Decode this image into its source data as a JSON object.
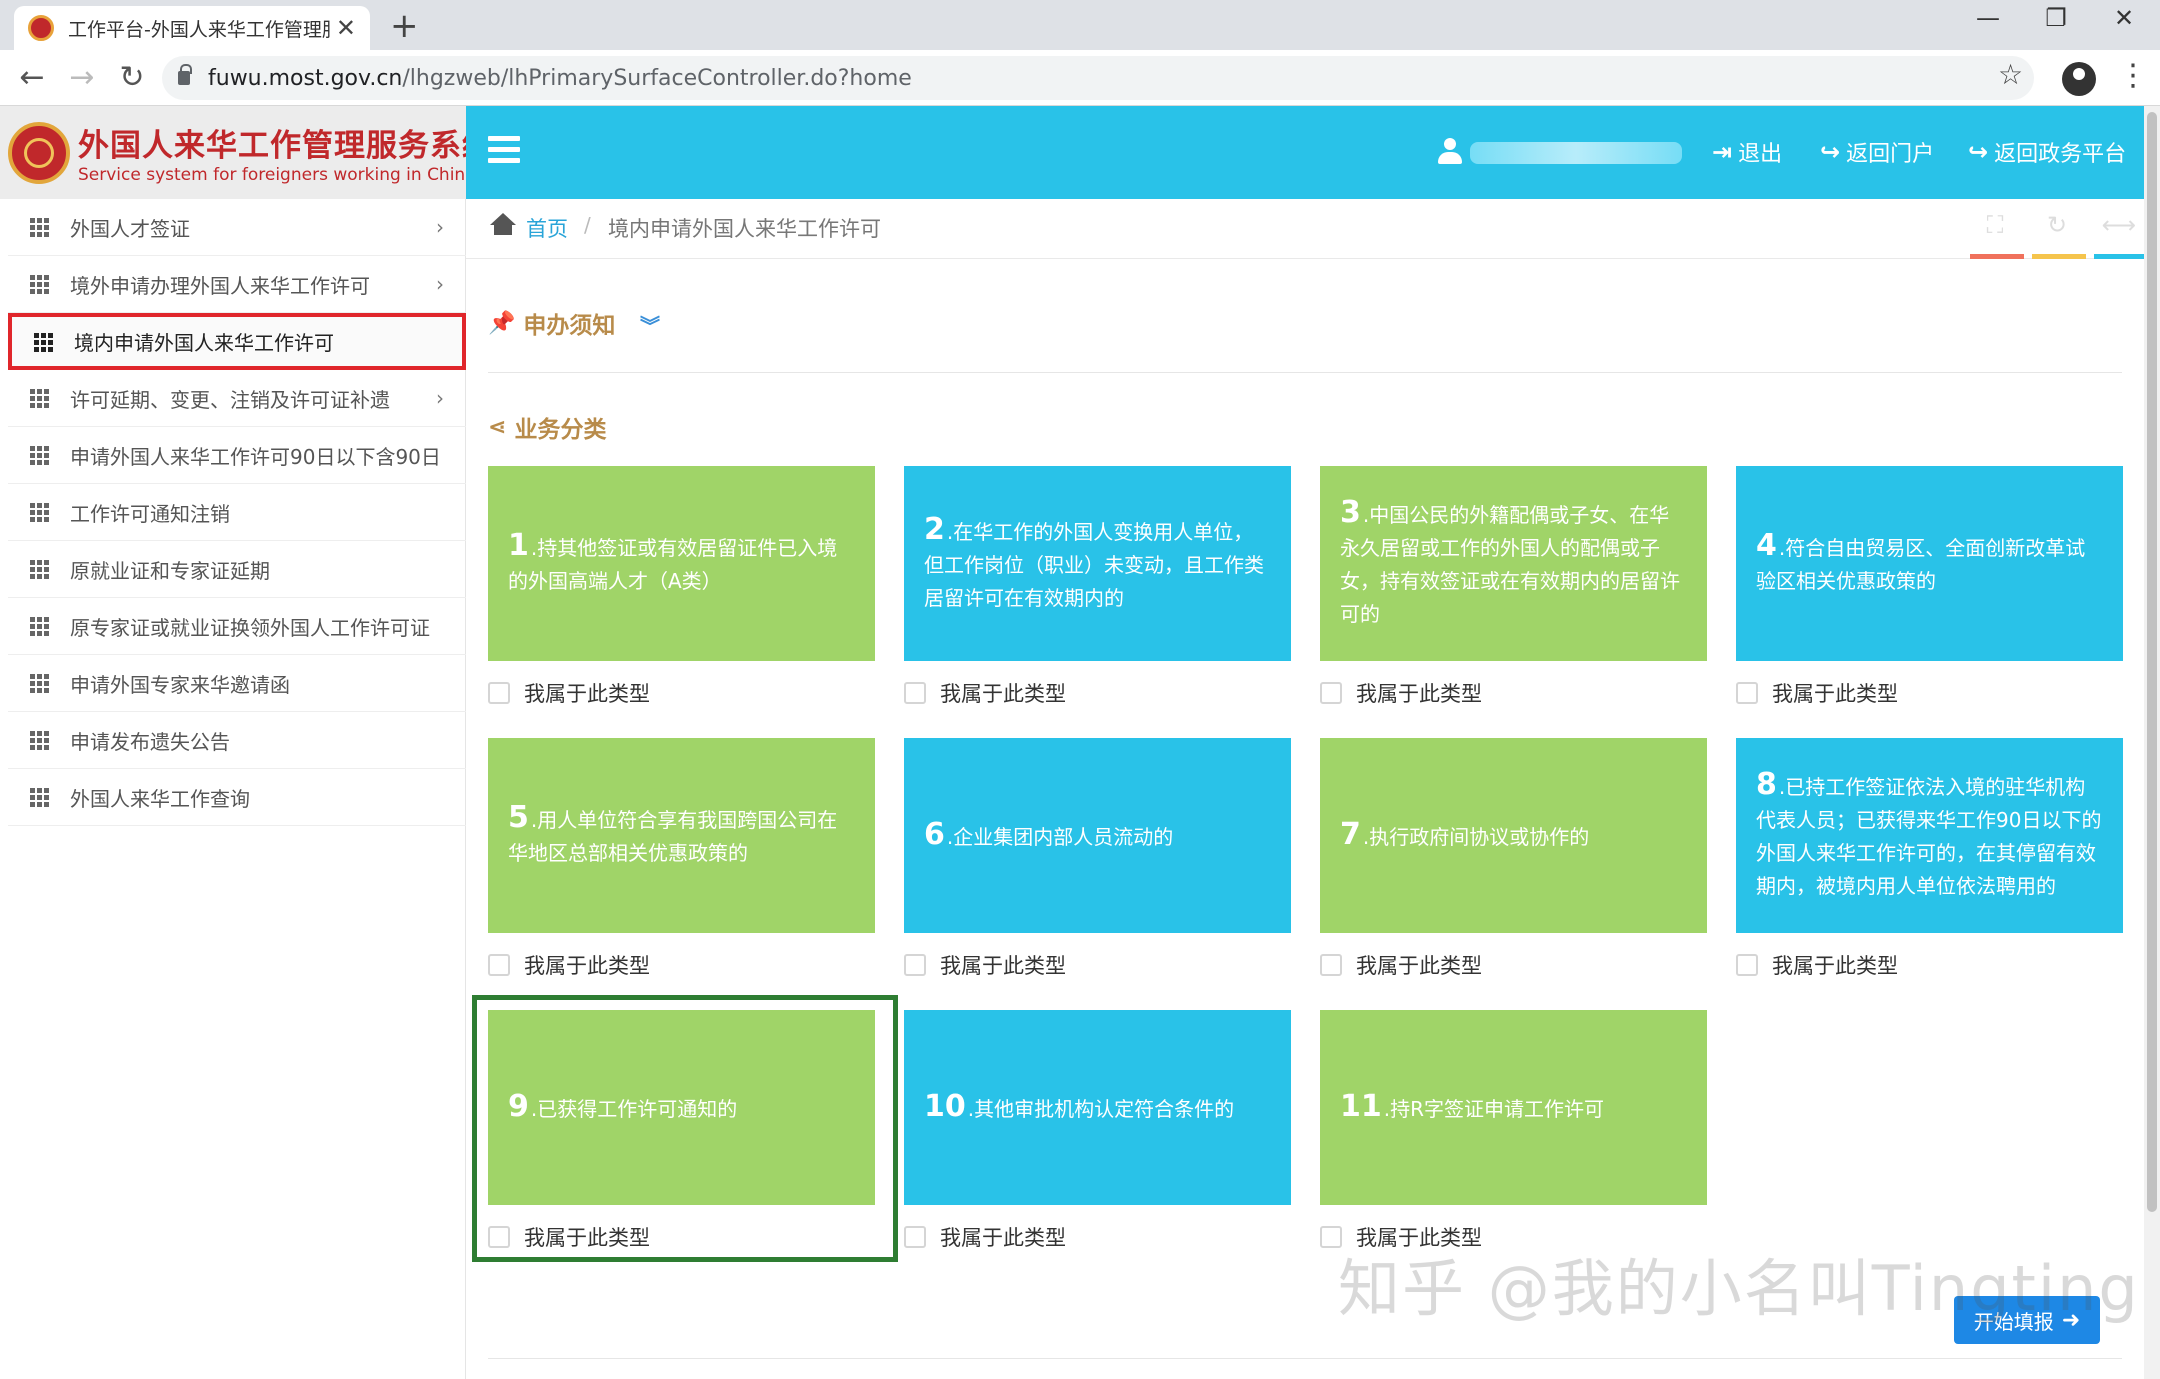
{
  "browser": {
    "tab_title": "工作平台-外国人来华工作管理服",
    "url_domain": "fuwu.most.gov.cn",
    "url_path": "/lhgzweb/lhPrimarySurfaceController.do?home"
  },
  "header": {
    "logo_cn": "外国人来华工作管理服务系统",
    "logo_en": "Service system for foreigners working in China",
    "logout": "退出",
    "back_portal": "返回门户",
    "back_gov": "返回政务平台"
  },
  "sidebar": {
    "items": [
      {
        "label": "外国人才签证"
      },
      {
        "label": "境外申请办理外国人来华工作许可"
      },
      {
        "label": "境内申请外国人来华工作许可"
      },
      {
        "label": "许可延期、变更、注销及许可证补遗"
      },
      {
        "label": "申请外国人来华工作许可90日以下含90日"
      },
      {
        "label": "工作许可通知注销"
      },
      {
        "label": "原就业证和专家证延期"
      },
      {
        "label": "原专家证或就业证换领外国人工作许可证"
      },
      {
        "label": "申请外国专家来华邀请函"
      },
      {
        "label": "申请发布遗失公告"
      },
      {
        "label": "外国人来华工作查询"
      }
    ]
  },
  "breadcrumb": {
    "home": "首页",
    "separator": "/",
    "current": "境内申请外国人来华工作许可"
  },
  "content": {
    "notice_title": "申办须知",
    "category_title": "业务分类",
    "checkbox_label": "我属于此类型",
    "start_button": "开始填报",
    "watermark": "知乎 @我的小名叫Tingting",
    "cards": [
      {
        "num": "1",
        "text": ".持其他签证或有效居留证件已入境的外国高端人才（A类）",
        "color": "green"
      },
      {
        "num": "2",
        "text": ".在华工作的外国人变换用人单位，但工作岗位（职业）未变动，且工作类居留许可在有效期内的",
        "color": "blue"
      },
      {
        "num": "3",
        "text": ".中国公民的外籍配偶或子女、在华永久居留或工作的外国人的配偶或子女，持有效签证或在有效期内的居留许可的",
        "color": "green"
      },
      {
        "num": "4",
        "text": ".符合自由贸易区、全面创新改革试验区相关优惠政策的",
        "color": "blue"
      },
      {
        "num": "5",
        "text": ".用人单位符合享有我国跨国公司在华地区总部相关优惠政策的",
        "color": "green"
      },
      {
        "num": "6",
        "text": ".企业集团内部人员流动的",
        "color": "blue"
      },
      {
        "num": "7",
        "text": ".执行政府间协议或协作的",
        "color": "green"
      },
      {
        "num": "8",
        "text": ".已持工作签证依法入境的驻华机构代表人员；已获得来华工作90日以下的外国人来华工作许可的，在其停留有效期内，被境内用人单位依法聘用的",
        "color": "blue"
      },
      {
        "num": "9",
        "text": ".已获得工作许可通知的",
        "color": "green"
      },
      {
        "num": "10",
        "text": ".其他审批机构认定符合条件的",
        "color": "blue"
      },
      {
        "num": "11",
        "text": ".持R字签证申请工作许可",
        "color": "green"
      }
    ]
  },
  "colors": {
    "accent_blue": "#29c2e8",
    "card_green": "#a0d468",
    "highlight_red": "#e0262b",
    "highlight_green": "#2e7d32",
    "section_gold": "#b88b4a"
  }
}
